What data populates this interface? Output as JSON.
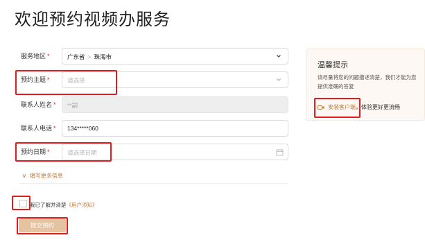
{
  "page": {
    "title": "欢迎预约视频办服务"
  },
  "form": {
    "region": {
      "label": "服务地区",
      "required_mark": "*",
      "province": "广东省",
      "separator": ">",
      "city": "珠海市"
    },
    "topic": {
      "label": "预约主题",
      "required_mark": "*",
      "placeholder": "请选择"
    },
    "name": {
      "label": "联系人姓名",
      "required_mark": "*",
      "value": "**嗣"
    },
    "phone": {
      "label": "联系人电话",
      "required_mark": "*",
      "value": "134*****060"
    },
    "date": {
      "label": "预约日期",
      "required_mark": "*",
      "placeholder": "请选择日期"
    },
    "more_info": {
      "arrow": "∨",
      "label": "填写更多信息"
    }
  },
  "agreement": {
    "text": "我已了解并清楚",
    "link": "《用户须知》"
  },
  "submit": {
    "label": "提交预约"
  },
  "tips": {
    "title": "温馨提示",
    "body": "请尽量将您的问题描述清楚，我们才能为您提供准确的答复",
    "install_label": "安装客户端",
    "install_suffix": "，体验更好更流畅"
  },
  "colors": {
    "accent": "#c07a3c",
    "required": "#e0211f",
    "annotation": "#e21c1c",
    "submit_bg": "#e6c3a0"
  }
}
